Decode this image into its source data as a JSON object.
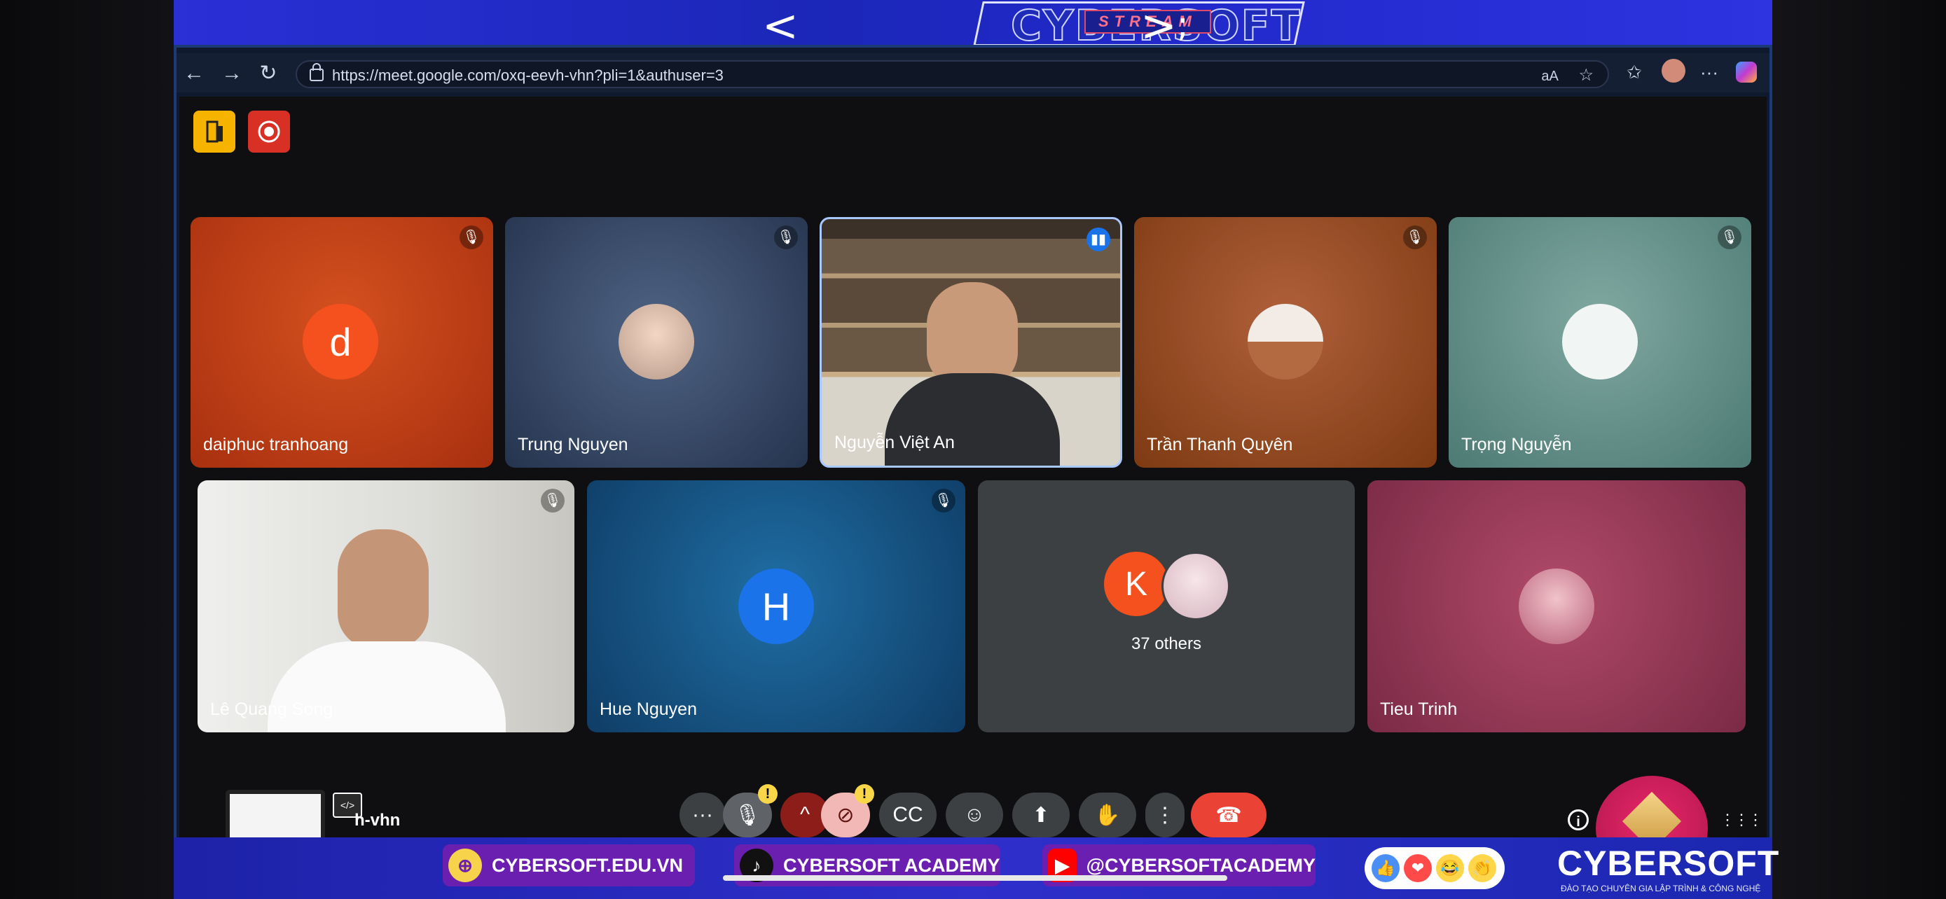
{
  "banner": {
    "logo_text": "CYBERSOFT",
    "stream_tag": "STREAM",
    "chev_left": "<",
    "chev_right": ">",
    "semicolon": ";"
  },
  "browser": {
    "url": "https://meet.google.com/oxq-eevh-vhn?pli=1&authuser=3",
    "read_aloud": "aA",
    "back_icon": "←",
    "forward_icon": "→",
    "reload_icon": "↻",
    "star_icon": "☆",
    "favorites_icon": "✩",
    "more_icon": "···"
  },
  "meeting": {
    "meeting_code_partial": "h-vhn",
    "participants": [
      {
        "name": "daiphuc tranhoang",
        "initial": "d",
        "muted": true
      },
      {
        "name": "Trung Nguyen",
        "muted": true
      },
      {
        "name": "Nguyễn Việt An",
        "speaking": true
      },
      {
        "name": "Trần Thanh Quyên",
        "muted": true
      },
      {
        "name": "Trọng Nguyễn",
        "muted": true
      },
      {
        "name": "Lê Quang Song",
        "muted": true
      },
      {
        "name": "Hue Nguyen",
        "initial": "H",
        "muted": true
      },
      {
        "name": "",
        "initial": "K",
        "others_label": "37 others"
      },
      {
        "name": "Tieu Trinh"
      }
    ],
    "controls": {
      "more": "···",
      "warning": "!",
      "caret": "^",
      "captions": "CC",
      "emoji": "☺",
      "present": "⬆",
      "raise_hand": "✋",
      "options": "⋮",
      "end_call": "☎",
      "info": "i",
      "apps": "⋮⋮⋮"
    }
  },
  "footer": {
    "website": "CYBERSOFT.EDU.VN",
    "tiktok": "CYBERSOFT ACADEMY",
    "youtube": "@CYBERSOFTACADEMY",
    "brand": "CYBERSOFT",
    "brand_sub": "ĐÀO TẠO CHUYÊN GIA LẬP TRÌNH & CÔNG NGHỆ",
    "web_icon": "⊕",
    "tiktok_icon": "♪",
    "youtube_icon": "▶",
    "react_like": "👍",
    "react_heart": "❤",
    "react_laugh": "😂",
    "react_clap": "👏"
  },
  "colors": {
    "accent": "#2a2fd6",
    "tile_red": "#c8401a",
    "end_call": "#ea4335",
    "meet_bg": "#0f0f12"
  }
}
